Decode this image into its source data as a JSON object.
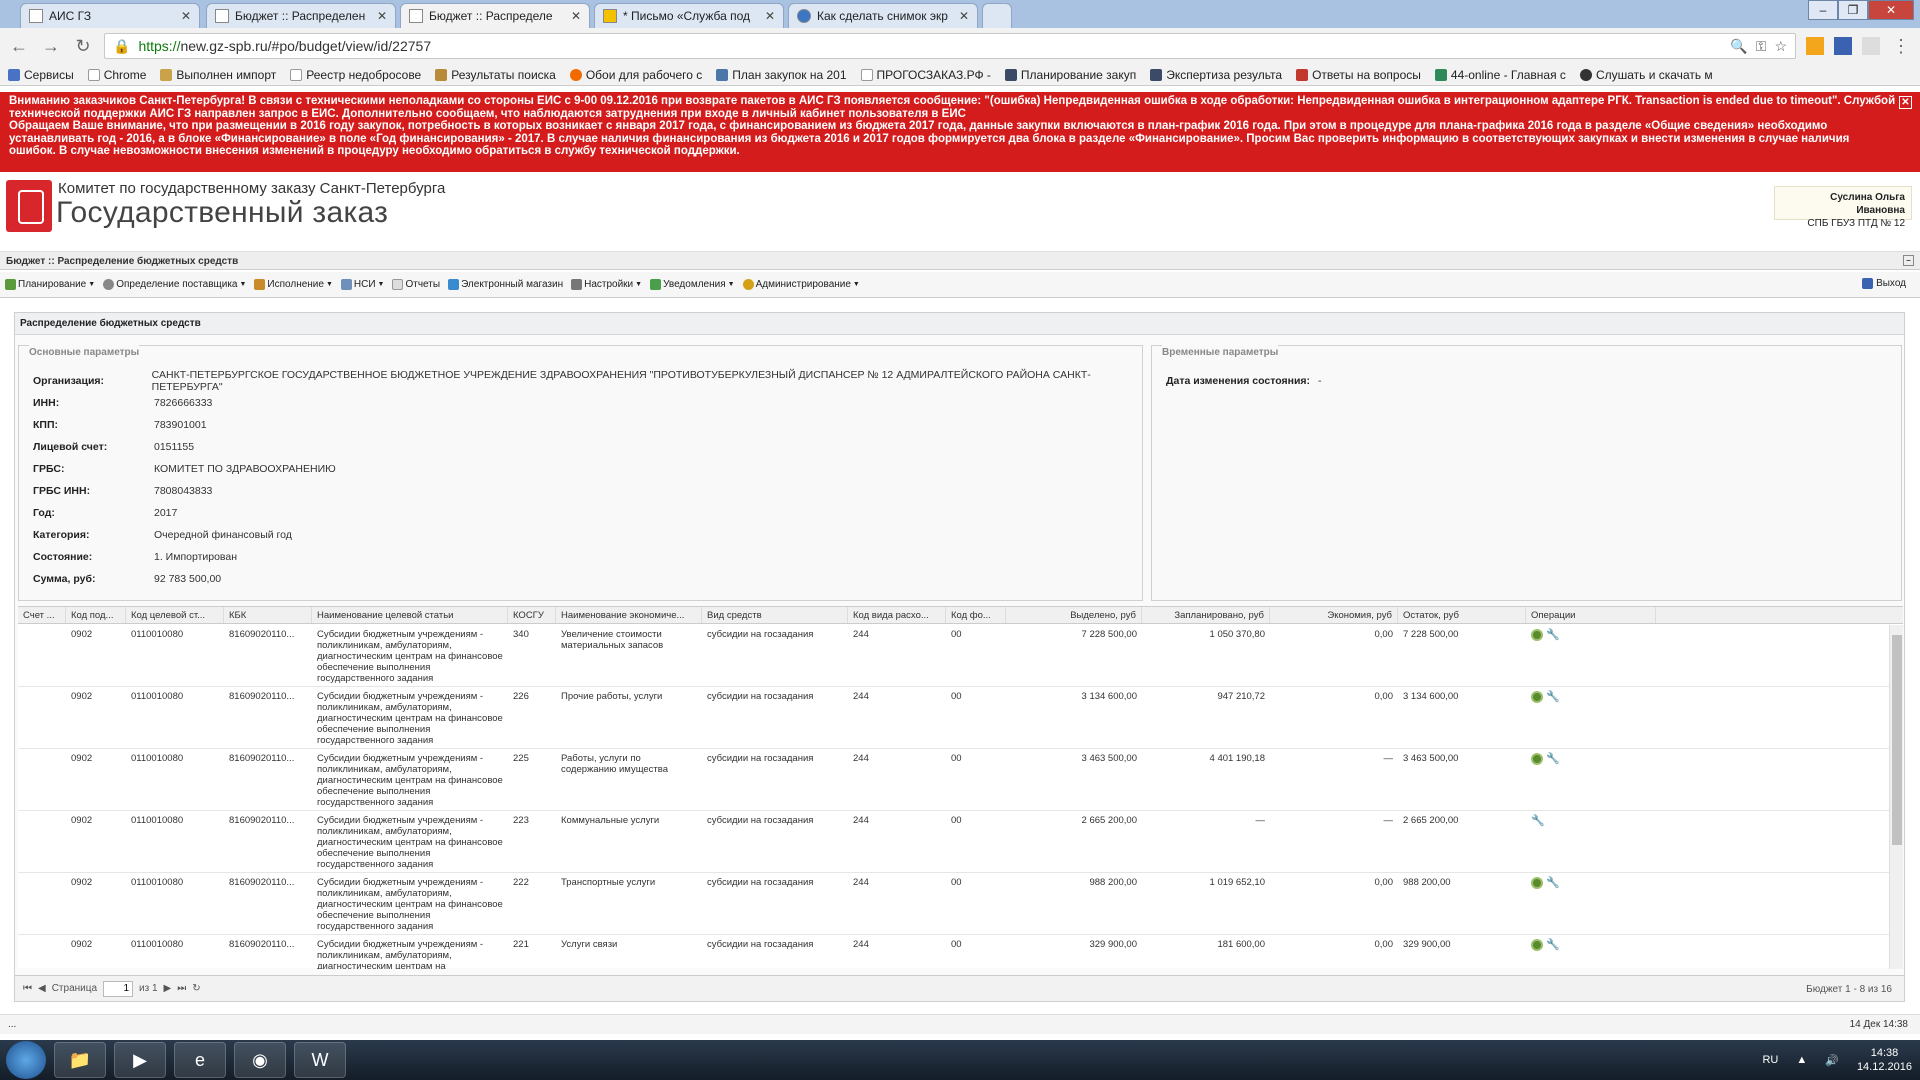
{
  "browser": {
    "tabs": [
      {
        "label": "АИС ГЗ"
      },
      {
        "label": "Бюджет :: Распределен"
      },
      {
        "label": "Бюджет :: Распределе"
      },
      {
        "label": "* Письмо «Служба под"
      },
      {
        "label": "Как сделать снимок экр"
      }
    ],
    "url_scheme": "https://",
    "url_host": "new.gz-spb.ru",
    "url_path": "/#po/budget/view/id/22757",
    "bookmarks": [
      "Сервисы",
      "Chrome",
      "Выполнен импорт",
      "Реестр недобросове",
      "Результаты поиска",
      "Обои для рабочего с",
      "План закупок на 201",
      "ПРОГОСЗАКАЗ.РФ -",
      "Планирование закуп",
      "Экспертиза результа",
      "Ответы на вопросы",
      "44-online - Главная с",
      "Слушать и скачать м"
    ]
  },
  "alert": {
    "text": "Вниманию заказчиков Санкт-Петербурга! В связи с техническими неполадками со стороны ЕИС с 9-00 09.12.2016 при возврате пакетов в АИС ГЗ появляется сообщение: \"(ошибка) Непредвиденная ошибка в ходе обработки: Непредвиденная ошибка в интеграционном адаптере РГК. Transaction is ended due to timeout\". Службой технической поддержки АИС ГЗ направлен запрос в ЕИС. Дополнительно сообщаем, что наблюдаются затруднения при входе в личный кабинет пользователя в ЕИС",
    "text2": "Обращаем Ваше внимание, что при размещении в 2016 году закупок, потребность в которых возникает с января 2017 года, с финансированием из бюджета 2017 года, данные закупки включаются в план-график 2016 года. При этом в процедуре для плана-графика 2016 года в разделе «Общие сведения» необходимо устанавливать год - 2016, а в блоке «Финансирование» в поле «Год финансирования» - 2017. В случае наличия финансирования из бюджета 2016 и 2017 годов формируется два блока в разделе «Финансирование». Просим Вас проверить информацию в соответствующих закупках и внести изменения в случае наличия ошибок. В случае невозможности внесения изменений в процедуру необходимо обратиться в службу технической поддержки."
  },
  "header": {
    "org_line1": "Комитет по государственному заказу Санкт-Петербурга",
    "org_line2": "Государственный заказ",
    "user_name": "Суслина Ольга Ивановна",
    "user_org": "СПБ ГБУЗ ПТД № 12"
  },
  "breadcrumb": "Бюджет :: Распределение бюджетных средств",
  "menu": [
    "Планирование",
    "Определение поставщика",
    "Исполнение",
    "НСИ",
    "Отчеты",
    "Электронный магазин",
    "Настройки",
    "Уведомления",
    "Администрирование"
  ],
  "exit_label": "Выход",
  "panel": {
    "title": "Распределение бюджетных средств",
    "main_legend": "Основные параметры",
    "temp_legend": "Временные параметры",
    "fields": [
      {
        "label": "Организация:",
        "value": "САНКТ-ПЕТЕРБУРГСКОЕ ГОСУДАРСТВЕННОЕ БЮДЖЕТНОЕ УЧРЕЖДЕНИЕ ЗДРАВООХРАНЕНИЯ \"ПРОТИВОТУБЕРКУЛЕЗНЫЙ ДИСПАНСЕР № 12 АДМИРАЛТЕЙСКОГО РАЙОНА САНКТ-ПЕТЕРБУРГА\""
      },
      {
        "label": "ИНН:",
        "value": "7826666333"
      },
      {
        "label": "КПП:",
        "value": "783901001"
      },
      {
        "label": "Лицевой счет:",
        "value": "0151155"
      },
      {
        "label": "ГРБС:",
        "value": "КОМИТЕТ ПО ЗДРАВООХРАНЕНИЮ"
      },
      {
        "label": "ГРБС ИНН:",
        "value": "7808043833"
      },
      {
        "label": "Год:",
        "value": "2017"
      },
      {
        "label": "Категория:",
        "value": "Очередной финансовый год"
      },
      {
        "label": "Состояние:",
        "value": "1. Импортирован"
      },
      {
        "label": "Сумма, руб:",
        "value": "92 783 500,00"
      }
    ],
    "temp_label": "Дата изменения состояния:",
    "temp_value": "-"
  },
  "grid": {
    "columns": [
      "Счет ...",
      "Код под...",
      "Код целевой ст...",
      "КБК",
      "Наименование целевой статьи",
      "КОСГУ",
      "Наименование экономиче...",
      "Вид средств",
      "Код вида расхо...",
      "Код фо...",
      "Выделено, руб",
      "Запланировано, руб",
      "Экономия, руб",
      "Остаток, руб",
      "Операции"
    ],
    "rows": [
      {
        "c1": "",
        "c2": "0902",
        "c3": "0110010080",
        "c4": "81609020110...",
        "c5": "Субсидии бюджетным учреждениям - поликлиникам, амбулаториям, диагностическим центрам на финансовое обеспечение выполнения государственного задания",
        "c6": "340",
        "c7": "Увеличение стоимости материальных запасов",
        "c8": "субсидии на госзадания",
        "c9": "244",
        "c10": "00",
        "c11": "7 228 500,00",
        "c12": "1 050 370,80",
        "c13": "0,00",
        "c14": "7 228 500,00"
      },
      {
        "c1": "",
        "c2": "0902",
        "c3": "0110010080",
        "c4": "81609020110...",
        "c5": "Субсидии бюджетным учреждениям - поликлиникам, амбулаториям, диагностическим центрам на финансовое обеспечение выполнения государственного задания",
        "c6": "226",
        "c7": "Прочие работы, услуги",
        "c8": "субсидии на госзадания",
        "c9": "244",
        "c10": "00",
        "c11": "3 134 600,00",
        "c12": "947 210,72",
        "c13": "0,00",
        "c14": "3 134 600,00"
      },
      {
        "c1": "",
        "c2": "0902",
        "c3": "0110010080",
        "c4": "81609020110...",
        "c5": "Субсидии бюджетным учреждениям - поликлиникам, амбулаториям, диагностическим центрам на финансовое обеспечение выполнения государственного задания",
        "c6": "225",
        "c7": "Работы, услуги по содержанию имущества",
        "c8": "субсидии на госзадания",
        "c9": "244",
        "c10": "00",
        "c11": "3 463 500,00",
        "c12": "4 401 190,18",
        "c13": "—",
        "c14": "3 463 500,00"
      },
      {
        "c1": "",
        "c2": "0902",
        "c3": "0110010080",
        "c4": "81609020110...",
        "c5": "Субсидии бюджетным учреждениям - поликлиникам, амбулаториям, диагностическим центрам на финансовое обеспечение выполнения государственного задания",
        "c6": "223",
        "c7": "Коммунальные услуги",
        "c8": "субсидии на госзадания",
        "c9": "244",
        "c10": "00",
        "c11": "2 665 200,00",
        "c12": "—",
        "c13": "—",
        "c14": "2 665 200,00"
      },
      {
        "c1": "",
        "c2": "0902",
        "c3": "0110010080",
        "c4": "81609020110...",
        "c5": "Субсидии бюджетным учреждениям - поликлиникам, амбулаториям, диагностическим центрам на финансовое обеспечение выполнения государственного задания",
        "c6": "222",
        "c7": "Транспортные услуги",
        "c8": "субсидии на госзадания",
        "c9": "244",
        "c10": "00",
        "c11": "988 200,00",
        "c12": "1 019 652,10",
        "c13": "0,00",
        "c14": "988 200,00"
      },
      {
        "c1": "",
        "c2": "0902",
        "c3": "0110010080",
        "c4": "81609020110...",
        "c5": "Субсидии бюджетным учреждениям - поликлиникам, амбулаториям, диагностическим центрам на",
        "c6": "221",
        "c7": "Услуги связи",
        "c8": "субсидии на госзадания",
        "c9": "244",
        "c10": "00",
        "c11": "329 900,00",
        "c12": "181 600,00",
        "c13": "0,00",
        "c14": "329 900,00"
      }
    ]
  },
  "pager": {
    "page_label": "Страница",
    "page": "1",
    "of_label": "из 1",
    "info": "Бюджет 1 - 8 из 16"
  },
  "status": {
    "left": "...",
    "date": "14 Дек 14:38"
  },
  "taskbar": {
    "lang": "RU",
    "time": "14:38",
    "date": "14.12.2016"
  }
}
